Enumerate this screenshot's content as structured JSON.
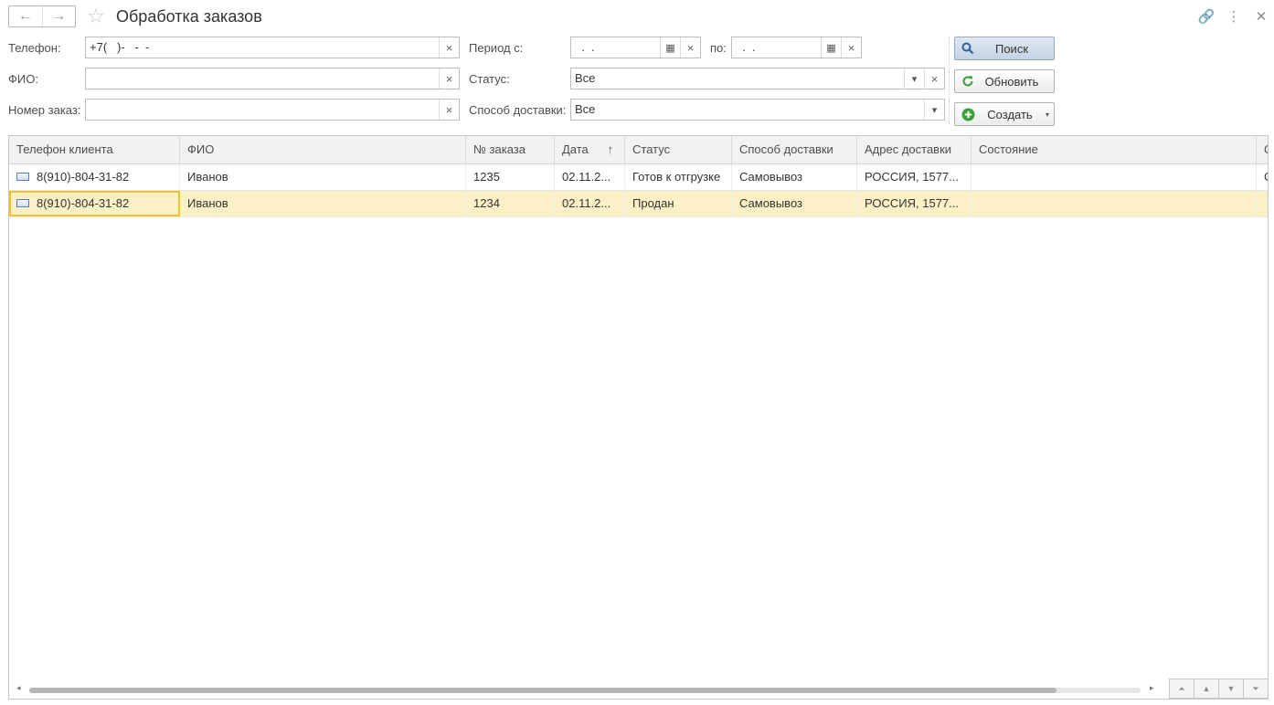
{
  "window": {
    "title": "Обработка заказов",
    "back_glyph": "←",
    "forward_glyph": "→",
    "star_glyph": "☆",
    "link_glyph": "🔗",
    "menu_glyph": "⋮",
    "close_glyph": "✕"
  },
  "filters": {
    "phone": {
      "label": "Телефон:",
      "value": "+7(   )-   -  -"
    },
    "fio": {
      "label": "ФИО:",
      "value": ""
    },
    "order_number": {
      "label": "Номер заказ:",
      "value": ""
    },
    "period_from": {
      "label": "Период с:",
      "value": "  .  ."
    },
    "period_to": {
      "label": "по:",
      "value": "  .  ."
    },
    "status": {
      "label": "Статус:",
      "value": "Все"
    },
    "delivery": {
      "label": "Способ доставки:",
      "value": "Все"
    },
    "clear_glyph": "×",
    "calendar_glyph": "▦",
    "dropdown_glyph": "▾"
  },
  "buttons": {
    "search": "Поиск",
    "refresh": "Обновить",
    "create": "Создать"
  },
  "table": {
    "columns": [
      "Телефон клиента",
      "ФИО",
      "№ заказа",
      "Дата",
      "Статус",
      "Способ доставки",
      "Адрес доставки",
      "Состояние",
      "С"
    ],
    "sort_glyph": "↑",
    "rows": [
      {
        "phone": "8(910)-804-31-82",
        "fio": "Иванов",
        "order": "1235",
        "date": "02.11.2...",
        "status": "Готов к отгрузке",
        "delivery": "Самовывоз",
        "address": "РОССИЯ, 1577...",
        "state": "",
        "extra": "С"
      },
      {
        "phone": "8(910)-804-31-82",
        "fio": "Иванов",
        "order": "1234",
        "date": "02.11.2...",
        "status": "Продан",
        "delivery": "Самовывоз",
        "address": "РОССИЯ, 1577...",
        "state": "",
        "extra": ""
      }
    ]
  },
  "scroll": {
    "left_glyph": "◂",
    "right_glyph": "▸",
    "nav": [
      "⏶",
      "▲",
      "▼",
      "⏷"
    ]
  },
  "colors": {
    "selected_row": "#fbf0c6",
    "focus_border": "#f2c227",
    "primary_button": "#c3d3e4"
  }
}
